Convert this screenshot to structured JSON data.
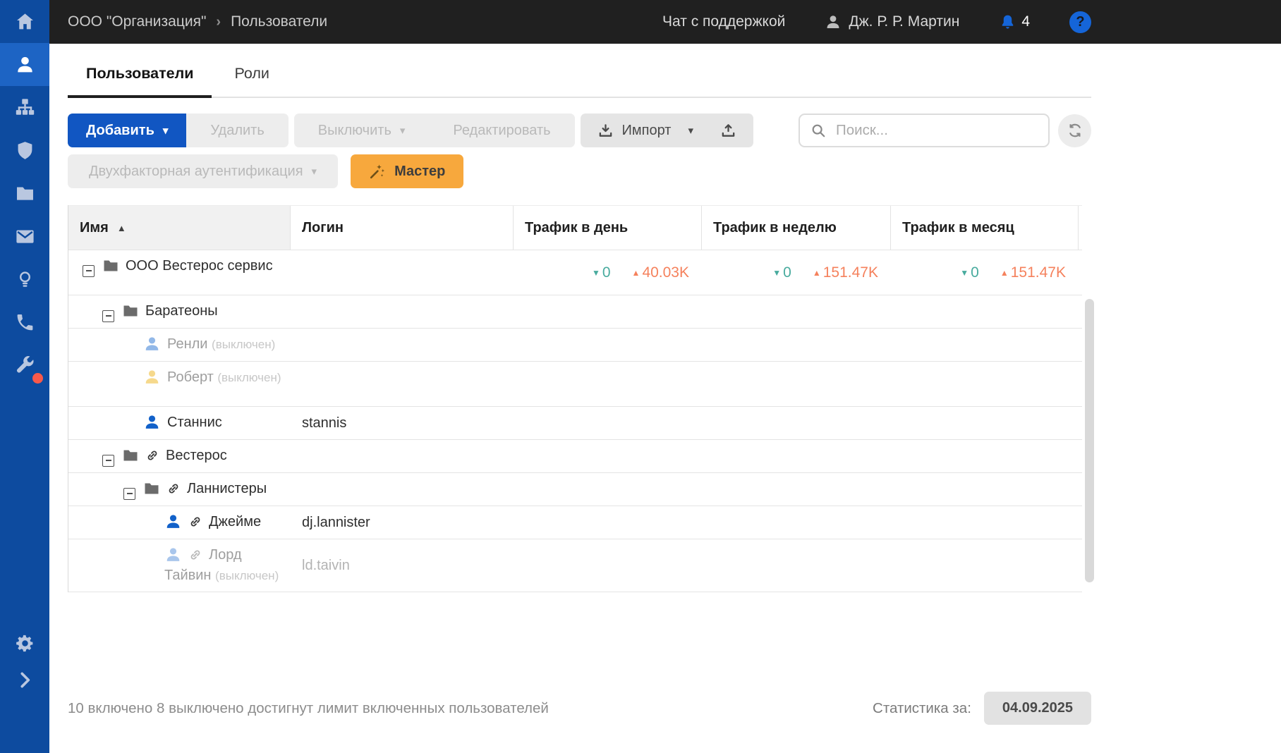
{
  "colors": {
    "sidebar": "#0d4b9f",
    "sidebar_active": "#1d64c4",
    "topbar": "#202020",
    "primary_button": "#1156c2",
    "master_button": "#f7a83d",
    "notification_blue": "#1565d8",
    "traffic_down_teal": "#48ab9e",
    "traffic_up_salmon": "#f5815c",
    "alert_dot_red": "#f9594a"
  },
  "topbar": {
    "breadcrumb": [
      "ООО \"Организация\"",
      "Пользователи"
    ],
    "support_chat": "Чат с поддержкой",
    "user_name": "Дж. Р. Р. Мартин",
    "notifications_count": "4",
    "help_label": "?"
  },
  "sidebar": {
    "items": [
      {
        "id": "home",
        "icon": "home"
      },
      {
        "id": "users",
        "icon": "user",
        "active": true
      },
      {
        "id": "structure",
        "icon": "sitemap"
      },
      {
        "id": "security",
        "icon": "shield"
      },
      {
        "id": "categories",
        "icon": "folder"
      },
      {
        "id": "mail",
        "icon": "mail"
      },
      {
        "id": "ideas",
        "icon": "lightbulb"
      },
      {
        "id": "telephony",
        "icon": "phone"
      },
      {
        "id": "tools",
        "icon": "wrench",
        "badge": true
      },
      {
        "id": "settings",
        "icon": "gear",
        "section": "bottom"
      },
      {
        "id": "collapse",
        "icon": "chevron-right",
        "section": "bottom"
      }
    ]
  },
  "tabs": [
    {
      "id": "users",
      "label": "Пользователи",
      "active": true
    },
    {
      "id": "roles",
      "label": "Роли",
      "active": false
    }
  ],
  "toolbar": {
    "add_label": "Добавить",
    "delete_label": "Удалить",
    "disable_label": "Выключить",
    "edit_label": "Редактировать",
    "import_label": "Импорт",
    "search_placeholder": "Поиск...",
    "two_factor_label": "Двухфакторная аутентификация",
    "master_label": "Мастер"
  },
  "table": {
    "columns": [
      {
        "id": "name",
        "label": "Имя",
        "sorted": "asc"
      },
      {
        "id": "login",
        "label": "Логин"
      },
      {
        "id": "traffic-day",
        "label": "Трафик в день"
      },
      {
        "id": "traffic-week",
        "label": "Трафик в неделю"
      },
      {
        "id": "traffic-month",
        "label": "Трафик в месяц"
      }
    ],
    "rows": [
      {
        "kind": "group",
        "name": "ООО Вестерос сервис",
        "indent": 20,
        "expander": true,
        "tall": true,
        "traffic": {
          "day": {
            "down": "0",
            "up": "40.03K"
          },
          "week": {
            "down": "0",
            "up": "151.47K"
          },
          "month": {
            "down": "0",
            "up": "151.47K"
          }
        }
      },
      {
        "kind": "group",
        "name": "Баратеоны",
        "indent": 48,
        "expander": true
      },
      {
        "kind": "user",
        "name": "Ренли",
        "suffix": "(выключен)",
        "disabled": true,
        "icon_color": "#92b8e8",
        "indent": 106
      },
      {
        "kind": "user",
        "name": "Роберт",
        "suffix": "(выключен)",
        "disabled": true,
        "icon_color": "#f6d98c",
        "indent": 106,
        "tall": true
      },
      {
        "kind": "user",
        "name": "Станнис",
        "login": "stannis",
        "icon_color": "#1261c9",
        "indent": 106
      },
      {
        "kind": "group",
        "name": "Вестерос",
        "indent": 48,
        "expander": true,
        "linked": true
      },
      {
        "kind": "group",
        "name": "Ланнистеры",
        "indent": 78,
        "expander": true,
        "linked": true
      },
      {
        "kind": "user",
        "name": "Джейме",
        "login": "dj.lannister",
        "icon_color": "#1261c9",
        "linked": true,
        "indent": 136
      },
      {
        "kind": "user",
        "name": "Лорд Тайвин",
        "suffix": "(выключен)",
        "login": "ld.taivin",
        "disabled": true,
        "icon_color": "#a9c6ec",
        "linked": true,
        "indent": 136,
        "tall": true
      }
    ]
  },
  "footer": {
    "status": "10 включено 8 выключено достигнут лимит включенных пользователей",
    "stats_label": "Статистика за:",
    "stats_date": "04.09.2025"
  }
}
